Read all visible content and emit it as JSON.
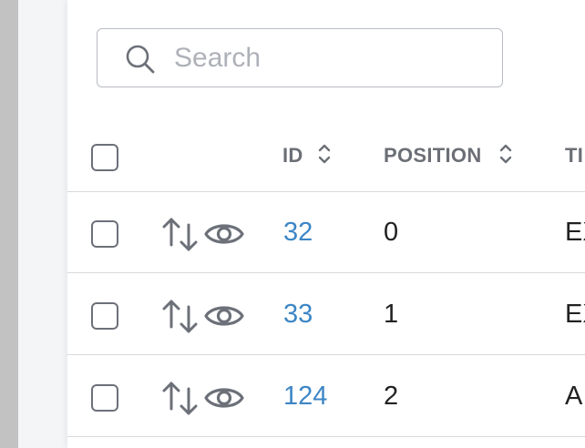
{
  "search": {
    "placeholder": "Search",
    "value": ""
  },
  "table": {
    "columns": [
      {
        "key": "id",
        "label": "ID",
        "sortable": true
      },
      {
        "key": "position",
        "label": "POSITION",
        "sortable": true
      },
      {
        "key": "title",
        "label": "TI",
        "sortable": false
      }
    ],
    "rows": [
      {
        "id": "32",
        "position": "0",
        "title": "EX"
      },
      {
        "id": "33",
        "position": "1",
        "title": "EX"
      },
      {
        "id": "124",
        "position": "2",
        "title": "A"
      }
    ]
  },
  "colors": {
    "link": "#3d86c6",
    "header_text": "#6b6f76",
    "icon": "#6c7078",
    "divider": "#d8dadd",
    "scrollbar": "#c2c2c2"
  },
  "icons": {
    "search": "search-icon",
    "sort": "sort-icon",
    "reorder": "reorder-arrows-icon",
    "view": "eye-icon"
  }
}
